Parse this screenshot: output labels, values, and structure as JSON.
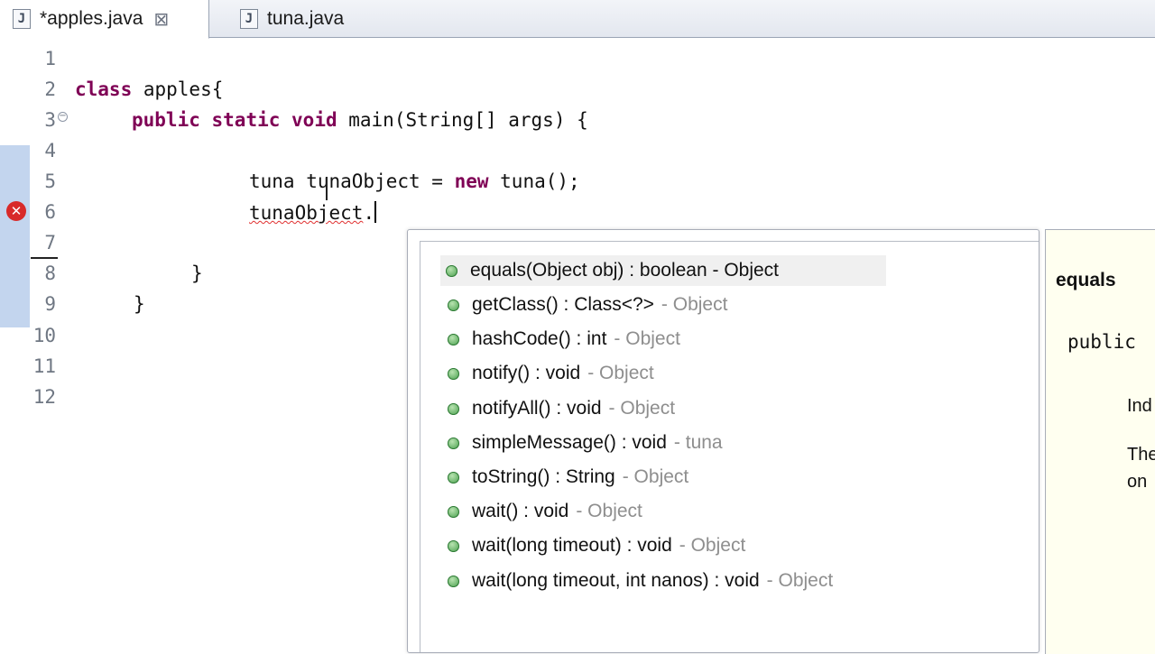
{
  "tabs": [
    {
      "label": "*apples.java",
      "active": true,
      "close": "⊠"
    },
    {
      "label": "tuna.java",
      "active": false
    }
  ],
  "editor": {
    "line_numbers": [
      "1",
      "2",
      "3",
      "4",
      "5",
      "6",
      "7",
      "8",
      "9",
      "10",
      "11",
      "12"
    ],
    "lines": {
      "l2_kw": "class",
      "l2_rest": " apples{",
      "l3_kw1": "public",
      "l3_kw2": "static",
      "l3_kw3": "void",
      "l3_rest": " main(String[] args) {",
      "l5_a": "tuna tunaObject = ",
      "l5_kw": "new",
      "l5_b": " tuna();",
      "l6_err": "tunaObject",
      "l6_dot": ".",
      "l8": "}",
      "l9": "}"
    },
    "error_icon": "error-x-icon",
    "fold_icon": "collapse-icon"
  },
  "content_assist": {
    "proposals": [
      {
        "sig": "equals(Object obj) : boolean - Object",
        "decl": ""
      },
      {
        "sig": "getClass() : Class<?>",
        "decl": "- Object"
      },
      {
        "sig": "hashCode() : int",
        "decl": "- Object"
      },
      {
        "sig": "notify() : void",
        "decl": "- Object"
      },
      {
        "sig": "notifyAll() : void",
        "decl": "- Object"
      },
      {
        "sig": "simpleMessage() : void",
        "decl": "- tuna"
      },
      {
        "sig": "toString() : String",
        "decl": "- Object"
      },
      {
        "sig": "wait() : void",
        "decl": "- Object"
      },
      {
        "sig": "wait(long timeout) : void",
        "decl": "- Object"
      },
      {
        "sig": "wait(long timeout, int nanos) : void",
        "decl": "- Object"
      }
    ],
    "selected_index": 0,
    "method_icon": "public-method-icon"
  },
  "javadoc": {
    "title": "equals",
    "signature": "public",
    "text1": "Ind",
    "text2": "The",
    "text3": "on"
  },
  "colors": {
    "keyword": "#7f0055",
    "error": "#d82a2a",
    "ruler_band": "#c3d5ee",
    "doc_bg": "#fffff0"
  }
}
